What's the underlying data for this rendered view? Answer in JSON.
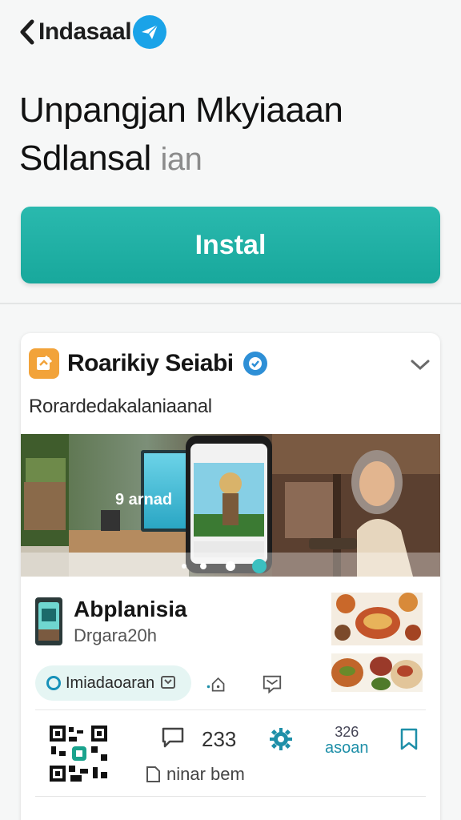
{
  "header": {
    "app_name": "Indasaal",
    "icons": {
      "back": "chevron-left-icon",
      "badge": "paper-plane-icon"
    },
    "badge_color": "#1aa3e8"
  },
  "headline": {
    "line1": "Unpangjan Mkyiaaan",
    "line2": "Sdlansal",
    "line2_faded": "ian"
  },
  "install": {
    "label": "Instal",
    "color": "#1ba99d"
  },
  "card": {
    "brand_title": "Roarikiy Seiabi",
    "subtitle": "Rorardedakalaniaanal",
    "icons": {
      "brand": "note-icon",
      "verified": "verified-check-icon",
      "expand": "chevron-down-icon"
    },
    "app": {
      "title": "Abplanisia",
      "meta": "Drgara20h"
    },
    "chip_label": "Imiadaoaran",
    "stats": {
      "comments": "233",
      "action_label": "ninar bem",
      "save_count": "326",
      "save_label": "asoan"
    },
    "hero_screen_text": "9 arnad"
  },
  "colors": {
    "accent": "#1ba99d",
    "link_blue": "#1e8fa8",
    "verified": "#2e8fd6"
  }
}
